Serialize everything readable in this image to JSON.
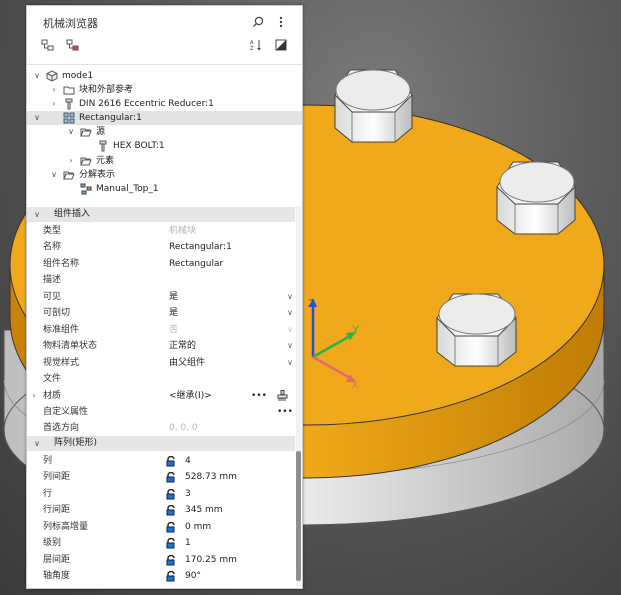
{
  "browser": {
    "title": "机械浏览器"
  },
  "tree": {
    "root": "mode1",
    "item1": "块和外部参考",
    "item2": "DIN 2616 Eccentric Reducer:1",
    "item3": "Rectangular:1",
    "item3_child1": "源",
    "item3_child1_child": "HEX BOLT:1",
    "item3_child2": "元素",
    "item4": "分解表示",
    "item4_child": "Manual_Top_1"
  },
  "section1": {
    "title": "组件插入",
    "props": [
      {
        "label": "类型",
        "value": "机械块"
      },
      {
        "label": "名称",
        "value": "Rectangular:1"
      },
      {
        "label": "组件名称",
        "value": "Rectangular"
      },
      {
        "label": "描述",
        "value": ""
      },
      {
        "label": "可见",
        "value": "是"
      },
      {
        "label": "可剖切",
        "value": "是"
      },
      {
        "label": "标准组件",
        "value": "否"
      },
      {
        "label": "物料清单状态",
        "value": "正常的"
      },
      {
        "label": "视觉样式",
        "value": "由父组件"
      },
      {
        "label": "文件",
        "value": ""
      },
      {
        "label": "材质",
        "value": "<继承(I)>"
      },
      {
        "label": "自定义属性",
        "value": ""
      },
      {
        "label": "首选方向",
        "value": "0, 0, 0"
      }
    ]
  },
  "section2": {
    "title": "阵列(矩形)",
    "props": [
      {
        "label": "列",
        "value": "4"
      },
      {
        "label": "列间距",
        "value": "528.73 mm"
      },
      {
        "label": "行",
        "value": "3"
      },
      {
        "label": "行间距",
        "value": "345 mm"
      },
      {
        "label": "列标高增量",
        "value": "0 mm"
      },
      {
        "label": "级别",
        "value": "1"
      },
      {
        "label": "层间距",
        "value": "170.25 mm"
      },
      {
        "label": "轴角度",
        "value": "90°"
      }
    ]
  },
  "axes": {
    "x": "X",
    "y": "Y",
    "z": "Z"
  },
  "colors": {
    "plate": "#f0a91a",
    "plate_dark": "#d48d06",
    "base": "#d9d9d9",
    "axis_x": "#e36a6a",
    "axis_y": "#26b34a",
    "axis_z": "#2a4fd6"
  }
}
